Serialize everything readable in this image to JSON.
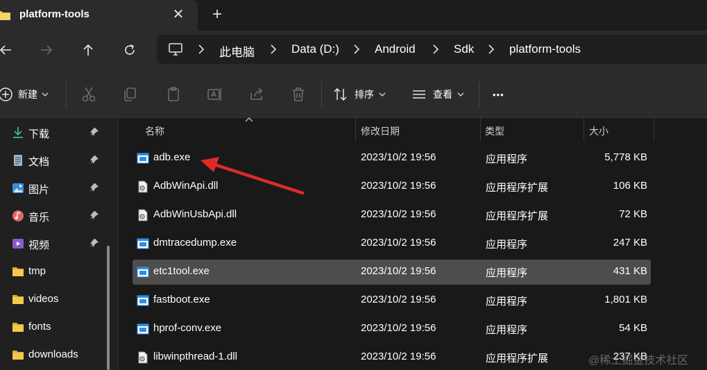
{
  "window": {
    "tab_title": "platform-tools",
    "close_symbol": "✕",
    "new_tab_symbol": "+"
  },
  "navigation": {
    "breadcrumbs": [
      "此电脑",
      "Data (D:)",
      "Android",
      "Sdk",
      "platform-tools"
    ]
  },
  "toolbar": {
    "new_label": "新建",
    "sort_label": "排序",
    "view_label": "查看",
    "more_label": "•••"
  },
  "sidebar": {
    "pinned": [
      {
        "label": "下载",
        "icon": "download-icon"
      },
      {
        "label": "文档",
        "icon": "document-icon"
      },
      {
        "label": "图片",
        "icon": "picture-icon"
      },
      {
        "label": "音乐",
        "icon": "music-icon"
      },
      {
        "label": "视频",
        "icon": "video-icon"
      }
    ],
    "folders": [
      {
        "label": "tmp",
        "icon": "folder-icon"
      },
      {
        "label": "videos",
        "icon": "folder-icon"
      },
      {
        "label": "fonts",
        "icon": "folder-icon"
      },
      {
        "label": "downloads",
        "icon": "folder-icon"
      }
    ]
  },
  "file_list": {
    "columns": [
      "名称",
      "修改日期",
      "类型",
      "大小"
    ],
    "rows": [
      {
        "name": "adb.exe",
        "date": "2023/10/2 19:56",
        "type": "应用程序",
        "size": "5,778 KB",
        "icon": "exe-icon"
      },
      {
        "name": "AdbWinApi.dll",
        "date": "2023/10/2 19:56",
        "type": "应用程序扩展",
        "size": "106 KB",
        "icon": "dll-icon"
      },
      {
        "name": "AdbWinUsbApi.dll",
        "date": "2023/10/2 19:56",
        "type": "应用程序扩展",
        "size": "72 KB",
        "icon": "dll-icon"
      },
      {
        "name": "dmtracedump.exe",
        "date": "2023/10/2 19:56",
        "type": "应用程序",
        "size": "247 KB",
        "icon": "exe-icon"
      },
      {
        "name": "etc1tool.exe",
        "date": "2023/10/2 19:56",
        "type": "应用程序",
        "size": "431 KB",
        "icon": "exe-icon",
        "selected": true
      },
      {
        "name": "fastboot.exe",
        "date": "2023/10/2 19:56",
        "type": "应用程序",
        "size": "1,801 KB",
        "icon": "exe-icon"
      },
      {
        "name": "hprof-conv.exe",
        "date": "2023/10/2 19:56",
        "type": "应用程序",
        "size": "54 KB",
        "icon": "exe-icon"
      },
      {
        "name": "libwinpthread-1.dll",
        "date": "2023/10/2 19:56",
        "type": "应用程序扩展",
        "size": "237 KB",
        "icon": "dll-icon"
      }
    ]
  },
  "watermark": "@稀土掘金技术社区",
  "colors": {
    "background": "#202020",
    "selected_row": "#4d4d4d",
    "annotation_arrow": "#e02a2a",
    "folder": "#f2c14e",
    "exe_blue": "#2f8ee0"
  }
}
